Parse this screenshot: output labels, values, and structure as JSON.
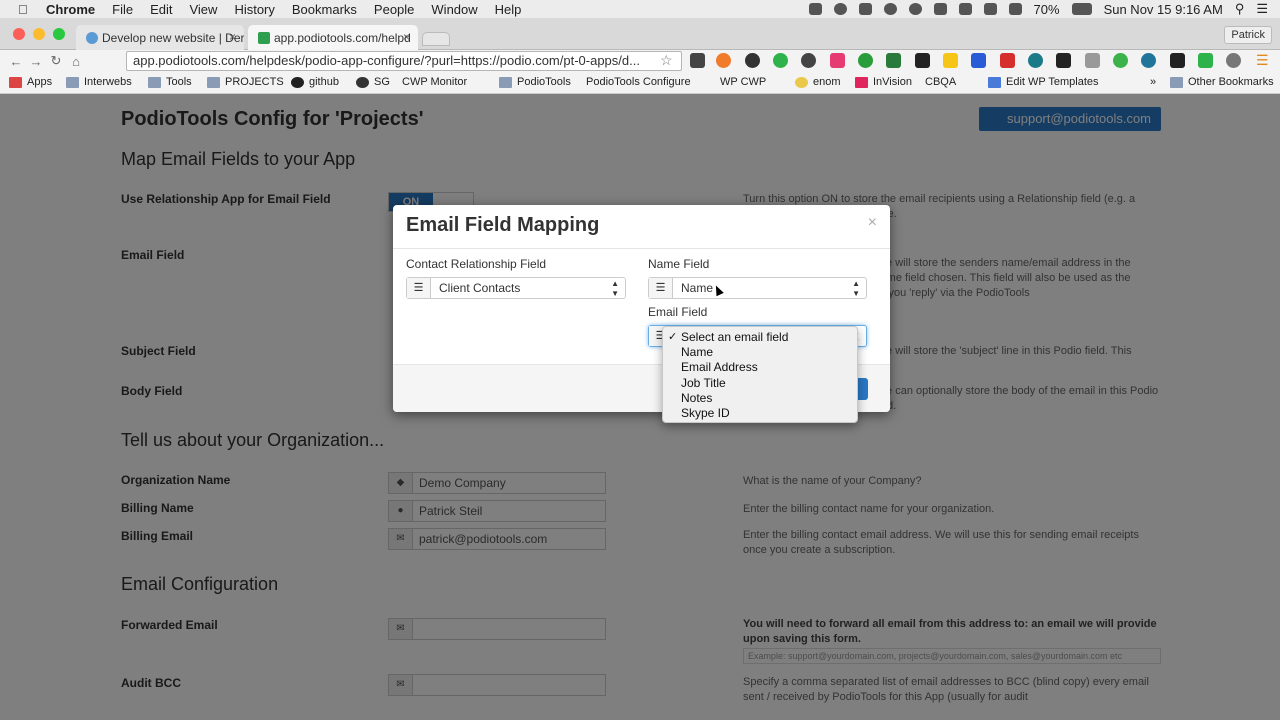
{
  "os_menu": {
    "app": "Chrome",
    "items": [
      "File",
      "Edit",
      "View",
      "History",
      "Bookmarks",
      "People",
      "Window",
      "Help"
    ],
    "battery": "70%",
    "clock": "Sun Nov 15  9:16 AM"
  },
  "browser": {
    "profile": "Patrick",
    "tabs": [
      {
        "title": "Develop new website | Der"
      },
      {
        "title": "app.podiotools.com/helpd"
      }
    ],
    "address": "app.podiotools.com/helpdesk/podio-app-configure/?purl=https://podio.com/pt-0-apps/d...",
    "bookmarks": [
      "Apps",
      "Interwebs",
      "Tools",
      "PROJECTS",
      "github",
      "SG",
      "CWP Monitor",
      "PodioTools",
      "PodioTools Configure",
      "WP CWP",
      "enom",
      "InVision",
      "CBQA",
      "Edit WP Templates",
      "Other Bookmarks"
    ]
  },
  "page": {
    "title": "PodioTools Config for 'Projects'",
    "support_button": "support@podiotools.com",
    "section_map": "Map Email Fields to your App",
    "use_relationship_label": "Use Relationship App for Email Field",
    "toggle_on": "ON",
    "use_relationship_help": "Turn this option ON to store the email recipients using a Relationship field (e.g. a \"Workspace Contact\" field type.",
    "email_field_label": "Email Field",
    "email_field_help": "When an email is received, we will store the senders name/email address in the Relationship field / Email / Name field chosen. This field will also be used as the recipient email address when you 'reply' via the PodioTools",
    "subject_label": "Subject Field",
    "subject_help": "When an email is received, we will store the 'subject' line in this Podio field. This should be a 'text' type field.",
    "body_label": "Body Field",
    "body_help": "When an email is received, we can optionally store the body of the email in this Podio field. This must be a \"text\" field.",
    "section_org": "Tell us about your Organization...",
    "org_name_label": "Organization Name",
    "org_name_value": "Demo Company",
    "org_name_help": "What is the name of your Company?",
    "billing_name_label": "Billing Name",
    "billing_name_value": "Patrick Steil",
    "billing_name_help": "Enter the billing contact name for your organization.",
    "billing_email_label": "Billing Email",
    "billing_email_value": "patrick@podiotools.com",
    "billing_email_help": "Enter the billing contact email address. We will use this for sending email receipts once you create a subscription.",
    "section_email": "Email Configuration",
    "forwarded_label": "Forwarded Email",
    "forwarded_help": "You will need to forward all email from this address to: an email we will provide upon saving this form.",
    "forwarded_example": "Example: support@yourdomain.com, projects@yourdomain.com, sales@yourdomain.com etc",
    "audit_label": "Audit BCC",
    "audit_help": "Specify a comma separated list of email addresses to BCC (blind copy) every email sent / received by PodioTools for this App (usually for audit"
  },
  "modal": {
    "title": "Email Field Mapping",
    "close": "×",
    "contact_label": "Contact Relationship Field",
    "contact_value": "Client Contacts",
    "name_label": "Name Field",
    "name_value": "Name",
    "email_label": "Email Field",
    "email_options": [
      "Select an email field",
      "Name",
      "Email Address",
      "Job Title",
      "Notes",
      "Skype ID"
    ],
    "email_selected_index": 0
  }
}
